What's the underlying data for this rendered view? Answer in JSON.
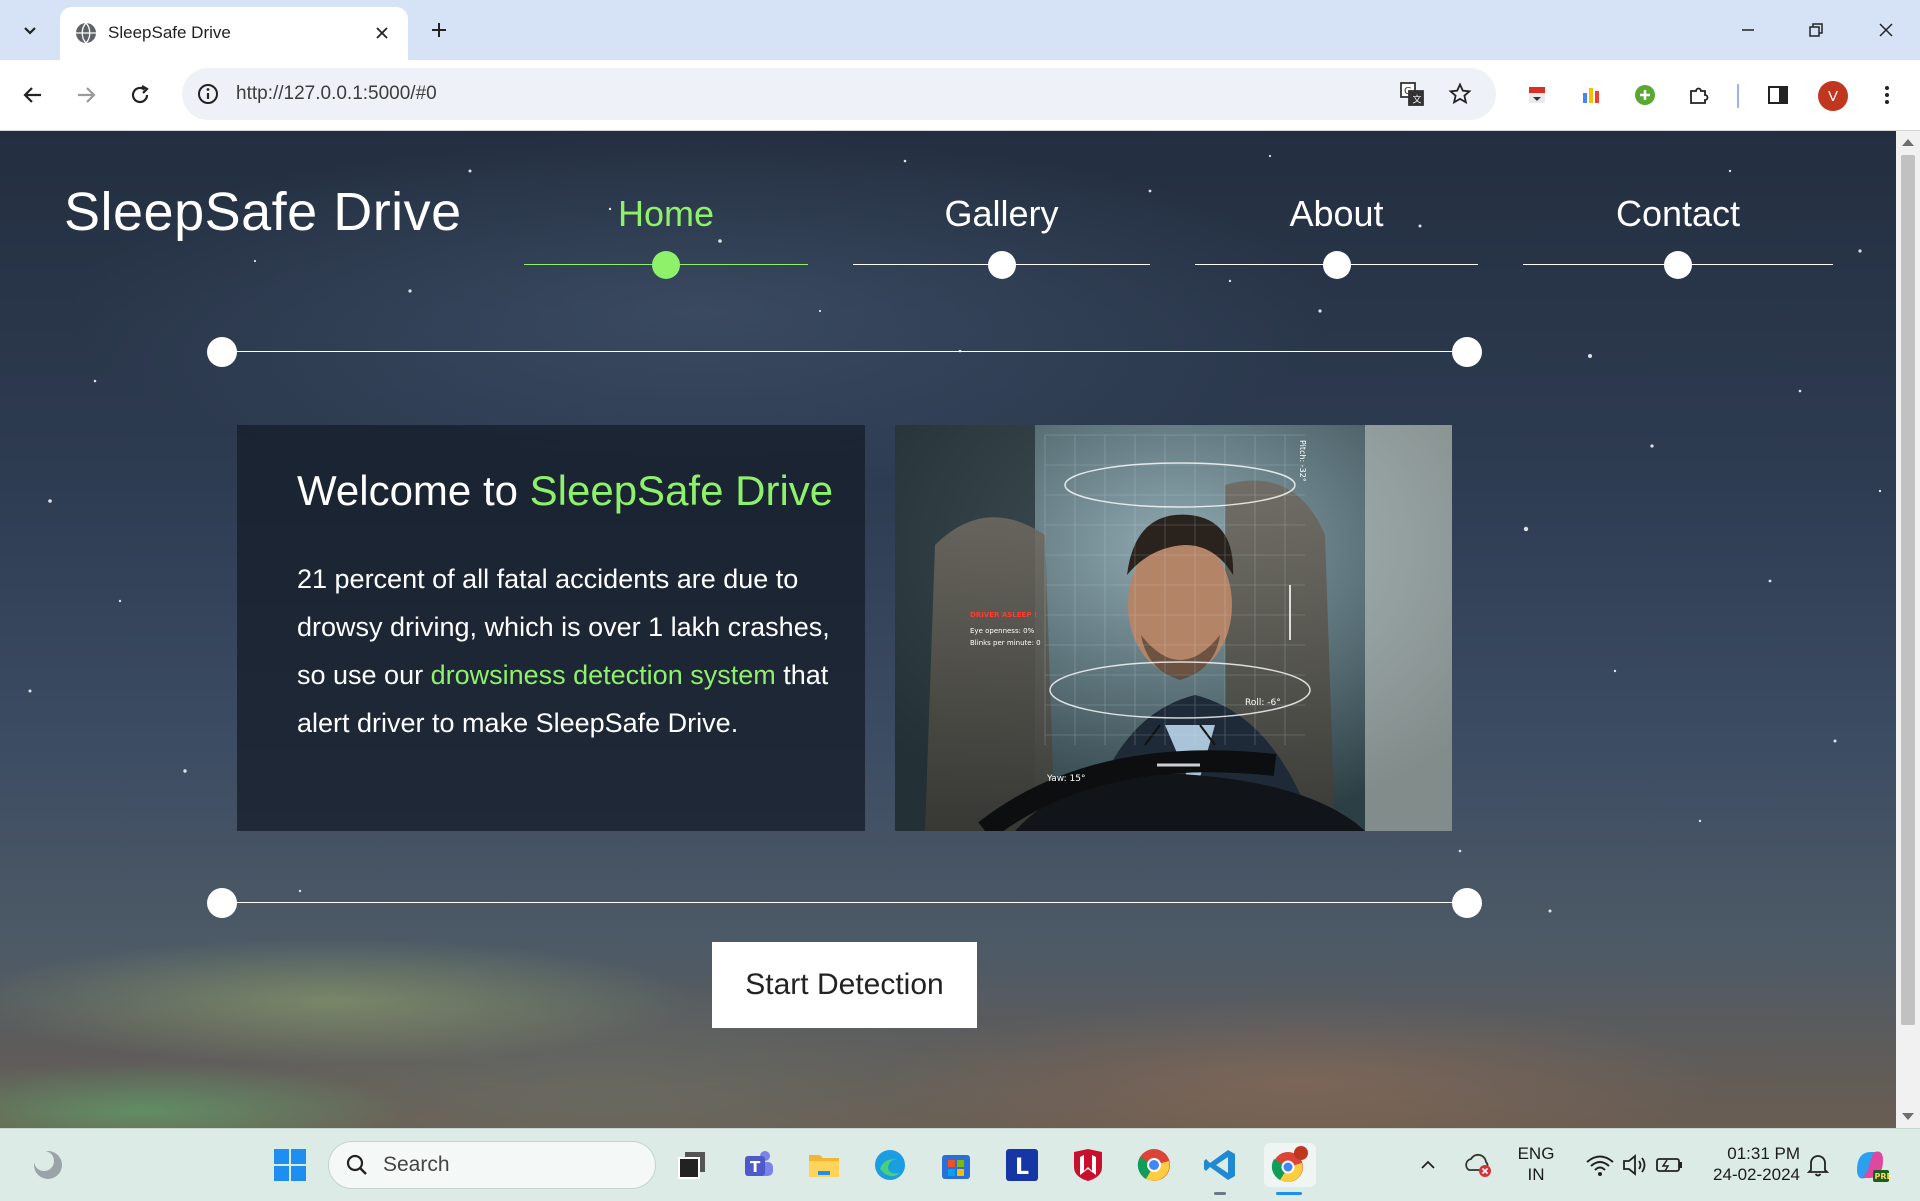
{
  "browser": {
    "tab_title": "SleepSafe Drive",
    "url": "http://127.0.0.1:5000/#0",
    "profile_initial": "V",
    "icons": {
      "tab_search": "chevron-down-icon",
      "favicon": "globe-icon",
      "close_tab": "close-icon",
      "new_tab": "plus-icon",
      "back": "back-arrow-icon",
      "forward": "forward-arrow-icon",
      "reload": "reload-icon",
      "site_info": "info-icon",
      "translate": "translate-icon",
      "bookmark": "star-icon",
      "extensions": "puzzle-icon",
      "side_panel": "side-panel-icon",
      "menu": "kebab-menu-icon"
    }
  },
  "site": {
    "brand": "SleepSafe Drive",
    "nav": [
      {
        "label": "Home",
        "active": true
      },
      {
        "label": "Gallery",
        "active": false
      },
      {
        "label": "About",
        "active": false
      },
      {
        "label": "Contact",
        "active": false
      }
    ],
    "welcome": {
      "title_prefix": "Welcome to ",
      "title_accent": "SleepSafe Drive",
      "body_before": "21 percent of all fatal accidents are due to drowsy driving, which is over 1 lakh crashes, so use our ",
      "body_link": "drowsiness detection system",
      "body_after": " that alert driver to make SleepSafe Drive."
    },
    "photo_overlay": {
      "alert": "DRIVER ASLEEP !",
      "eye_openness": "Eye openness: 0%",
      "blinks": "Blinks per minute: 0",
      "pitch": "Pitch: -32°",
      "roll": "Roll: -6°",
      "yaw": "Yaw: 15°"
    },
    "cta_label": "Start Detection",
    "accent_color": "#8ef16a"
  },
  "taskbar": {
    "search_placeholder": "Search",
    "lang_top": "ENG",
    "lang_bottom": "IN",
    "time": "01:31 PM",
    "date": "24-02-2024"
  }
}
